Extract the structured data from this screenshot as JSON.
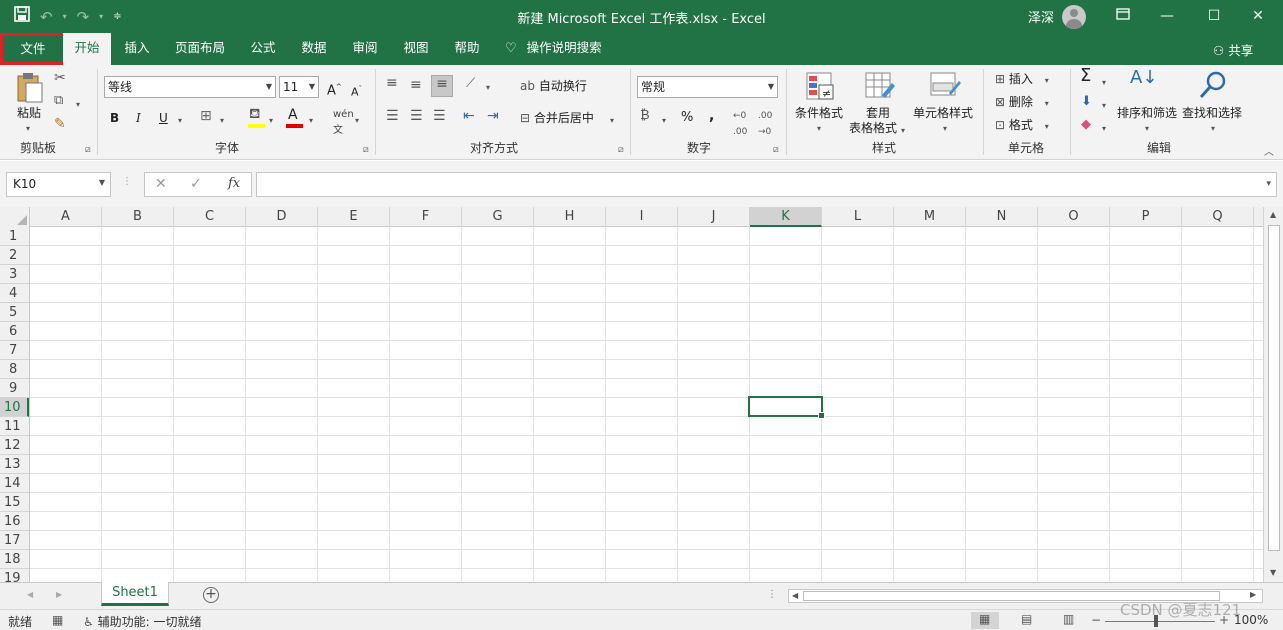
{
  "titlebar": {
    "title": "新建 Microsoft Excel 工作表.xlsx  -  Excel",
    "user": "泽深"
  },
  "tabs": [
    {
      "label": "文件"
    },
    {
      "label": "开始"
    },
    {
      "label": "插入"
    },
    {
      "label": "页面布局"
    },
    {
      "label": "公式"
    },
    {
      "label": "数据"
    },
    {
      "label": "审阅"
    },
    {
      "label": "视图"
    },
    {
      "label": "帮助"
    }
  ],
  "tell_me": "操作说明搜索",
  "share": "共享",
  "ribbon": {
    "clipboard": {
      "paste": "粘贴",
      "label": "剪贴板"
    },
    "font": {
      "name": "等线",
      "size": "11",
      "bold": "B",
      "italic": "I",
      "underline": "U",
      "label": "字体",
      "font_color": "#e00000",
      "fill_color": "#ffff00"
    },
    "alignment": {
      "wrap": "自动换行",
      "merge": "合并后居中",
      "label": "对齐方式"
    },
    "number": {
      "format": "常规",
      "label": "数字"
    },
    "styles": {
      "conditional": "条件格式",
      "table_line1": "套用",
      "table_line2": "表格格式",
      "cell_styles": "单元格样式",
      "label": "样式"
    },
    "cells": {
      "insert": "插入",
      "delete": "删除",
      "format": "格式",
      "label": "单元格"
    },
    "editing": {
      "sort": "排序和筛选",
      "find": "查找和选择",
      "label": "编辑"
    }
  },
  "formula_bar": {
    "name_box": "K10",
    "fx": "fx",
    "value": ""
  },
  "grid": {
    "columns": [
      "A",
      "B",
      "C",
      "D",
      "E",
      "F",
      "G",
      "H",
      "I",
      "J",
      "K",
      "L",
      "M",
      "N",
      "O",
      "P",
      "Q"
    ],
    "rows": [
      "1",
      "2",
      "3",
      "4",
      "5",
      "6",
      "7",
      "8",
      "9",
      "10",
      "11",
      "12",
      "13",
      "14",
      "15",
      "16",
      "17",
      "18",
      "19"
    ],
    "selected_col": "K",
    "selected_row": "10"
  },
  "sheets": [
    {
      "name": "Sheet1"
    }
  ],
  "status": {
    "ready": "就绪",
    "accessibility": "辅助功能: 一切就绪",
    "zoom": "100%"
  },
  "watermark": "CSDN @夏志121",
  "colors": {
    "accent": "#217346",
    "highlight": "#e21f26"
  }
}
